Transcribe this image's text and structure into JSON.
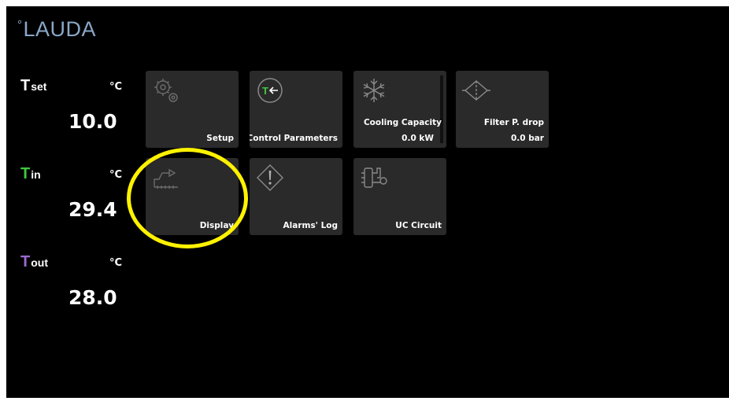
{
  "brand": {
    "name": "LAUDA",
    "degree": "°"
  },
  "temperatures": [
    {
      "letter": "T",
      "subscript": "set",
      "unit": "°C",
      "value": "10.0",
      "color": "#ffffff"
    },
    {
      "letter": "T",
      "subscript": "in",
      "unit": "°C",
      "value": "29.4",
      "color": "#3ec93e"
    },
    {
      "letter": "T",
      "subscript": "out",
      "unit": "°C",
      "value": "28.0",
      "color": "#9a6ad0"
    }
  ],
  "tiles": {
    "setup": {
      "label": "Setup",
      "icon": "gears-icon"
    },
    "control": {
      "label": "Control Parameters",
      "icon": "t-arrow-icon",
      "accent": "#3ec93e"
    },
    "cooling": {
      "label": "Cooling Capacity",
      "value": "0.0 kW",
      "icon": "snowflake-icon"
    },
    "filter": {
      "label": "Filter P. drop",
      "value": "0.0 bar",
      "icon": "filter-icon"
    },
    "display": {
      "label": "Display",
      "icon": "display-graph-icon"
    },
    "alarms": {
      "label": "Alarms' Log",
      "icon": "warning-icon"
    },
    "uc": {
      "label": "UC Circuit",
      "icon": "circuit-icon"
    }
  },
  "annotation": {
    "highlight_color": "#fff200",
    "target": "Display"
  }
}
